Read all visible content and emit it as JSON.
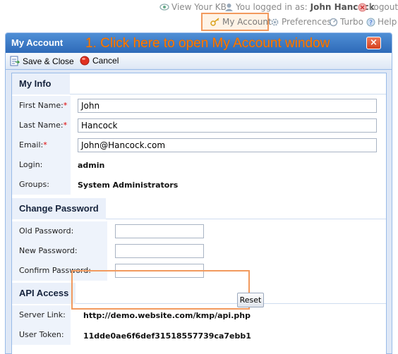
{
  "topbar": {
    "view_kb": "View Your KB",
    "logged_in_prefix": "You logged in as:",
    "user_name": "John Hancock",
    "logout": "Logout",
    "my_account": "My Account",
    "preferences": "Preferences",
    "turbo": "Turbo",
    "help": "Help"
  },
  "window": {
    "title": "My Account",
    "callout": "1. Click here to open My Account window",
    "close": "×"
  },
  "toolbar": {
    "save_close": "Save & Close",
    "cancel": "Cancel"
  },
  "my_info": {
    "heading": "My Info",
    "first_name_label": "First Name:",
    "first_name_value": "John",
    "last_name_label": "Last Name:",
    "last_name_value": "Hancock",
    "email_label": "Email:",
    "email_value": "John@Hancock.com",
    "required_mark": "*",
    "login_label": "Login:",
    "login_value": "admin",
    "groups_label": "Groups:",
    "groups_value": "System Administrators"
  },
  "change_password": {
    "heading": "Change Password",
    "old_label": "Old Password:",
    "new_label": "New Password:",
    "confirm_label": "Confirm Password:"
  },
  "api_access": {
    "heading": "API Access",
    "server_link_label": "Server Link:",
    "server_link_value": "http://demo.website.com/kmp/api.php",
    "user_token_label": "User Token:",
    "user_token_value": "11dde0ae6f6def31518557739ca7ebb1",
    "reset_label": "Reset"
  },
  "colors": {
    "title_bar": "#2e6ab8",
    "callout": "#ff7a00",
    "highlight_border": "#f29a5e",
    "section_bg": "#eaf0fa"
  }
}
